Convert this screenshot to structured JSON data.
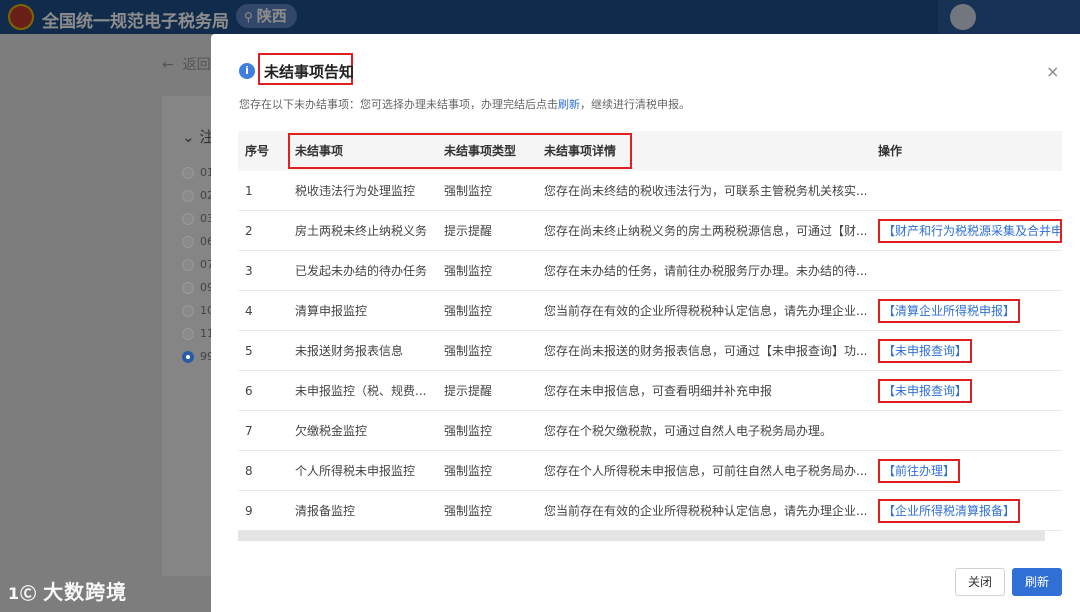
{
  "app": {
    "title": "全国统一规范电子税务局",
    "region": "陕西",
    "back_label": "返回",
    "section_label": "注",
    "radio_items": [
      "01",
      "02",
      "03",
      "06",
      "07",
      "09",
      "10",
      "11",
      "99"
    ]
  },
  "watermark": {
    "logo": "1Ⓒ",
    "text": "大数跨境"
  },
  "modal": {
    "title": "未结事项告知",
    "close_symbol": "×",
    "note_prefix": "您存在以下未办结事项：您可选择办理未结事项，办理完结后点击",
    "note_link": "刷新",
    "note_suffix": "，继续进行清税申报。",
    "columns": [
      "序号",
      "未结事项",
      "未结事项类型",
      "未结事项详情",
      "操作"
    ],
    "rows": [
      {
        "no": "1",
        "item": "税收违法行为处理监控",
        "type": "强制监控",
        "detail": "您存在尚未终结的税收违法行为，可联系主管税务机关核实...",
        "action": ""
      },
      {
        "no": "2",
        "item": "房土两税未终止纳税义务",
        "type": "提示提醒",
        "detail": "您存在尚未终止纳税义务的房土两税税源信息，可通过【财...",
        "action": "【财产和行为税税源采集及合并申..."
      },
      {
        "no": "3",
        "item": "已发起未办结的待办任务",
        "type": "强制监控",
        "detail": "您存在未办结的任务，请前往办税服务厅办理。未办结的待...",
        "action": ""
      },
      {
        "no": "4",
        "item": "清算申报监控",
        "type": "强制监控",
        "detail": "您当前存在有效的企业所得税税种认定信息，请先办理企业...",
        "action": "【清算企业所得税申报】"
      },
      {
        "no": "5",
        "item": "未报送财务报表信息",
        "type": "强制监控",
        "detail": "您存在尚未报送的财务报表信息，可通过【未申报查询】功...",
        "action": "【未申报查询】"
      },
      {
        "no": "6",
        "item": "未申报监控（税、规费...",
        "type": "提示提醒",
        "detail": "您存在未申报信息，可查看明细并补充申报",
        "action": "【未申报查询】"
      },
      {
        "no": "7",
        "item": "欠缴税金监控",
        "type": "强制监控",
        "detail": "您存在个税欠缴税款，可通过自然人电子税务局办理。",
        "action": ""
      },
      {
        "no": "8",
        "item": "个人所得税未申报监控",
        "type": "强制监控",
        "detail": "您存在个人所得税未申报信息，可前往自然人电子税务局办...",
        "action": "【前往办理】"
      },
      {
        "no": "9",
        "item": "清报备监控",
        "type": "强制监控",
        "detail": "您当前存在有效的企业所得税税种认定信息，请先办理企业...",
        "action": "【企业所得税清算报备】"
      }
    ],
    "buttons": {
      "close": "关闭",
      "refresh": "刷新"
    }
  },
  "colors": {
    "accent": "#2f6fd6",
    "highlight": "#e02020",
    "header": "#1f4e8a"
  }
}
